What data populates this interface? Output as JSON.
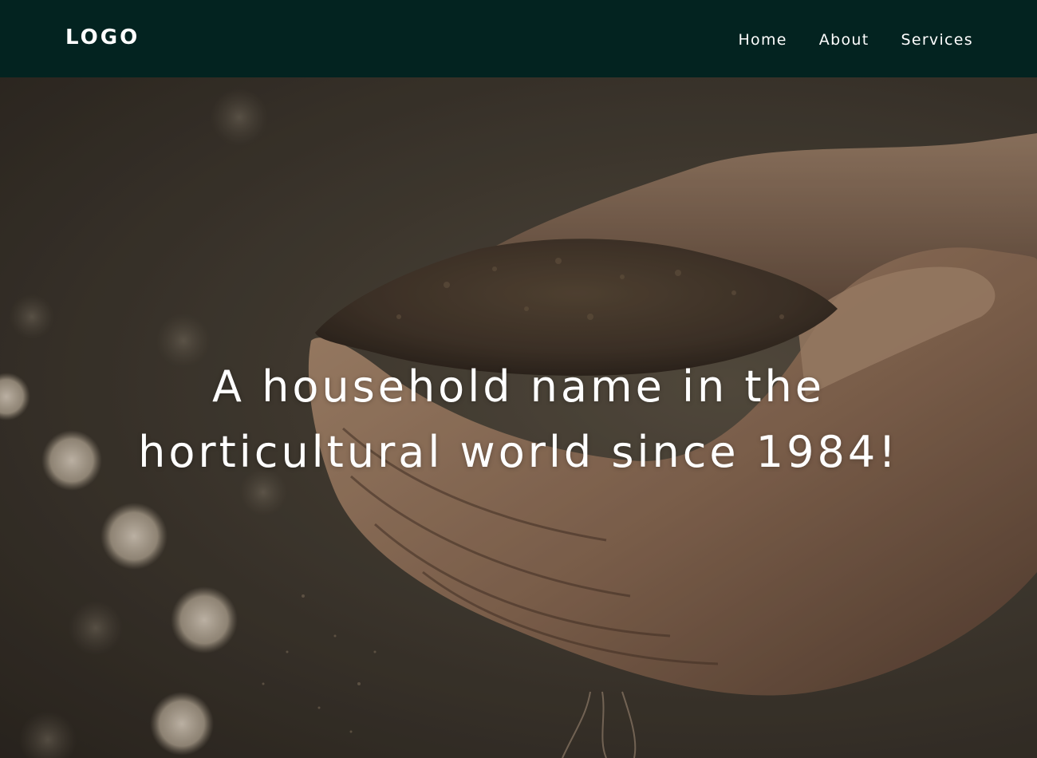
{
  "header": {
    "logo_text": "LOGO",
    "nav": [
      {
        "label": "Home"
      },
      {
        "label": "About"
      },
      {
        "label": "Services"
      }
    ]
  },
  "hero": {
    "headline_line1": "A household name in the",
    "headline_line2": "horticultural world since 1984!",
    "image_subject": "hands-holding-soil-photo"
  },
  "colors": {
    "navbar_bg": "#032320",
    "text": "#ffffff",
    "soil": "#4a3b2c",
    "skin": "#a07e64"
  }
}
